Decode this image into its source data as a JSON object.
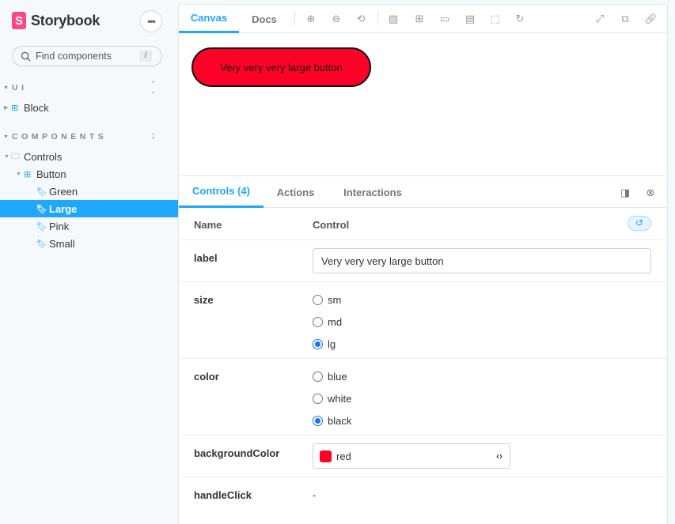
{
  "sidebar": {
    "brand": "Storybook",
    "brand_logo_letter": "S",
    "menu_icon": "ellipsis-icon",
    "search": {
      "placeholder": "Find components",
      "shortcut": "/"
    },
    "sections": [
      {
        "title": "UI",
        "items": [
          {
            "label": "Block",
            "type": "component"
          }
        ]
      },
      {
        "title": "COMPONENTS",
        "items": [
          {
            "label": "Controls",
            "type": "folder"
          },
          {
            "label": "Button",
            "type": "component"
          },
          {
            "label": "Green",
            "type": "story"
          },
          {
            "label": "Large",
            "type": "story",
            "selected": true
          },
          {
            "label": "Pink",
            "type": "story"
          },
          {
            "label": "Small",
            "type": "story"
          }
        ]
      }
    ]
  },
  "toolbar": {
    "tabs": [
      {
        "label": "Canvas",
        "active": true
      },
      {
        "label": "Docs",
        "active": false
      }
    ],
    "icons": [
      "zoom-in-icon",
      "zoom-out-icon",
      "zoom-reset-icon",
      "background-icon",
      "grid-icon",
      "viewport-icon",
      "measure-icon",
      "outline-icon",
      "remount-icon",
      "fullscreen-icon",
      "open-new-tab-icon",
      "copy-link-icon"
    ]
  },
  "canvas": {
    "button_label": "Very very very large button",
    "button_color": "#ff0026"
  },
  "panel": {
    "tabs": [
      {
        "label": "Controls (4)",
        "active": true
      },
      {
        "label": "Actions",
        "active": false
      },
      {
        "label": "Interactions",
        "active": false
      }
    ],
    "table": {
      "header_name": "Name",
      "header_control": "Control",
      "rows": {
        "label": {
          "name": "label",
          "value": "Very very very large button"
        },
        "size": {
          "name": "size",
          "options": [
            "sm",
            "md",
            "lg"
          ],
          "selected": "lg"
        },
        "color": {
          "name": "color",
          "options": [
            "blue",
            "white",
            "black"
          ],
          "selected": "black"
        },
        "backgroundColor": {
          "name": "backgroundColor",
          "value": "red",
          "swatch": "#ff0026"
        },
        "handleClick": {
          "name": "handleClick",
          "value": "-"
        }
      }
    }
  },
  "colors": {
    "accent": "#1ea7fd",
    "brand": "#ff4785"
  }
}
